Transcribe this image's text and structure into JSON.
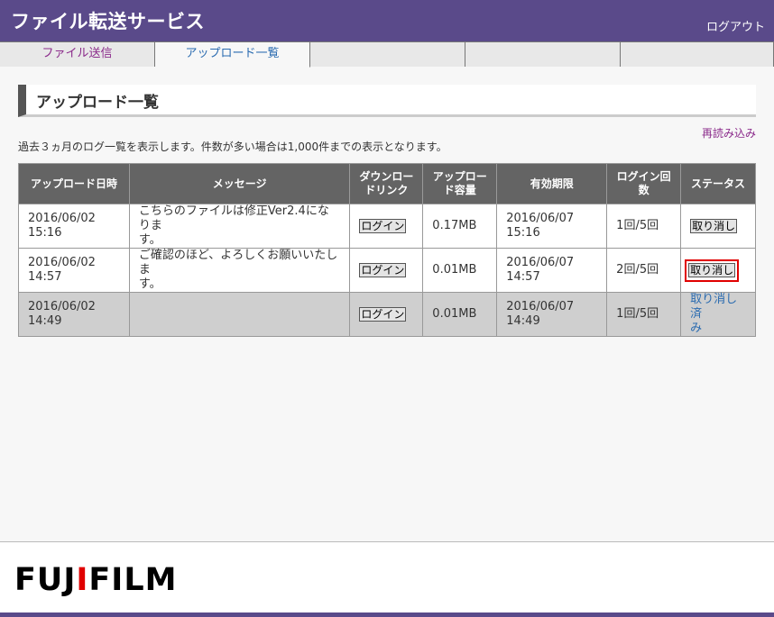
{
  "header": {
    "title": "ファイル転送サービス",
    "logout": "ログアウト"
  },
  "tabs": [
    {
      "label": "ファイル送信",
      "active": false
    },
    {
      "label": "アップロード一覧",
      "active": true
    },
    {
      "label": "",
      "active": false
    },
    {
      "label": "",
      "active": false
    },
    {
      "label": ""
    }
  ],
  "page": {
    "heading": "アップロード一覧",
    "reload": "再読み込み",
    "notice": "過去３ヵ月のログ一覧を表示します。件数が多い場合は1,000件までの表示となります。"
  },
  "table": {
    "headers": {
      "date": "アップロード日時",
      "message": "メッセージ",
      "download_1": "ダウンロー",
      "download_2": "ドリンク",
      "size_1": "アップロー",
      "size_2": "ド容量",
      "expires": "有効期限",
      "login_1": "ログイン回",
      "login_2": "数",
      "status": "ステータス"
    },
    "rows": [
      {
        "date_1": "2016/06/02",
        "date_2": "15:16",
        "message_1": "こちらのファイルは修正Ver2.4になりま",
        "message_2": "す。",
        "link": "ログイン",
        "size": "0.17MB",
        "expires_1": "2016/06/07",
        "expires_2": "15:16",
        "logins": "1回/5回",
        "status": "取り消し"
      },
      {
        "date_1": "2016/06/02",
        "date_2": "14:57",
        "message_1": "ご確認のほど、よろしくお願いいたしま",
        "message_2": "す。",
        "link": "ログイン",
        "size": "0.01MB",
        "expires_1": "2016/06/07",
        "expires_2": "14:57",
        "logins": "2回/5回",
        "status": "取り消し"
      },
      {
        "date_1": "2016/06/02",
        "date_2": "14:49",
        "message_1": "",
        "message_2": "",
        "link": "ログイン",
        "size": "0.01MB",
        "expires_1": "2016/06/07",
        "expires_2": "14:49",
        "logins": "1回/5回",
        "status_1": "取り消し済",
        "status_2": "み"
      }
    ]
  },
  "footer": {
    "logo_a": "FUJ",
    "logo_b": "I",
    "logo_c": "FILM"
  },
  "colors": {
    "brand": "#5a4a8a",
    "highlight": "#e00000"
  }
}
